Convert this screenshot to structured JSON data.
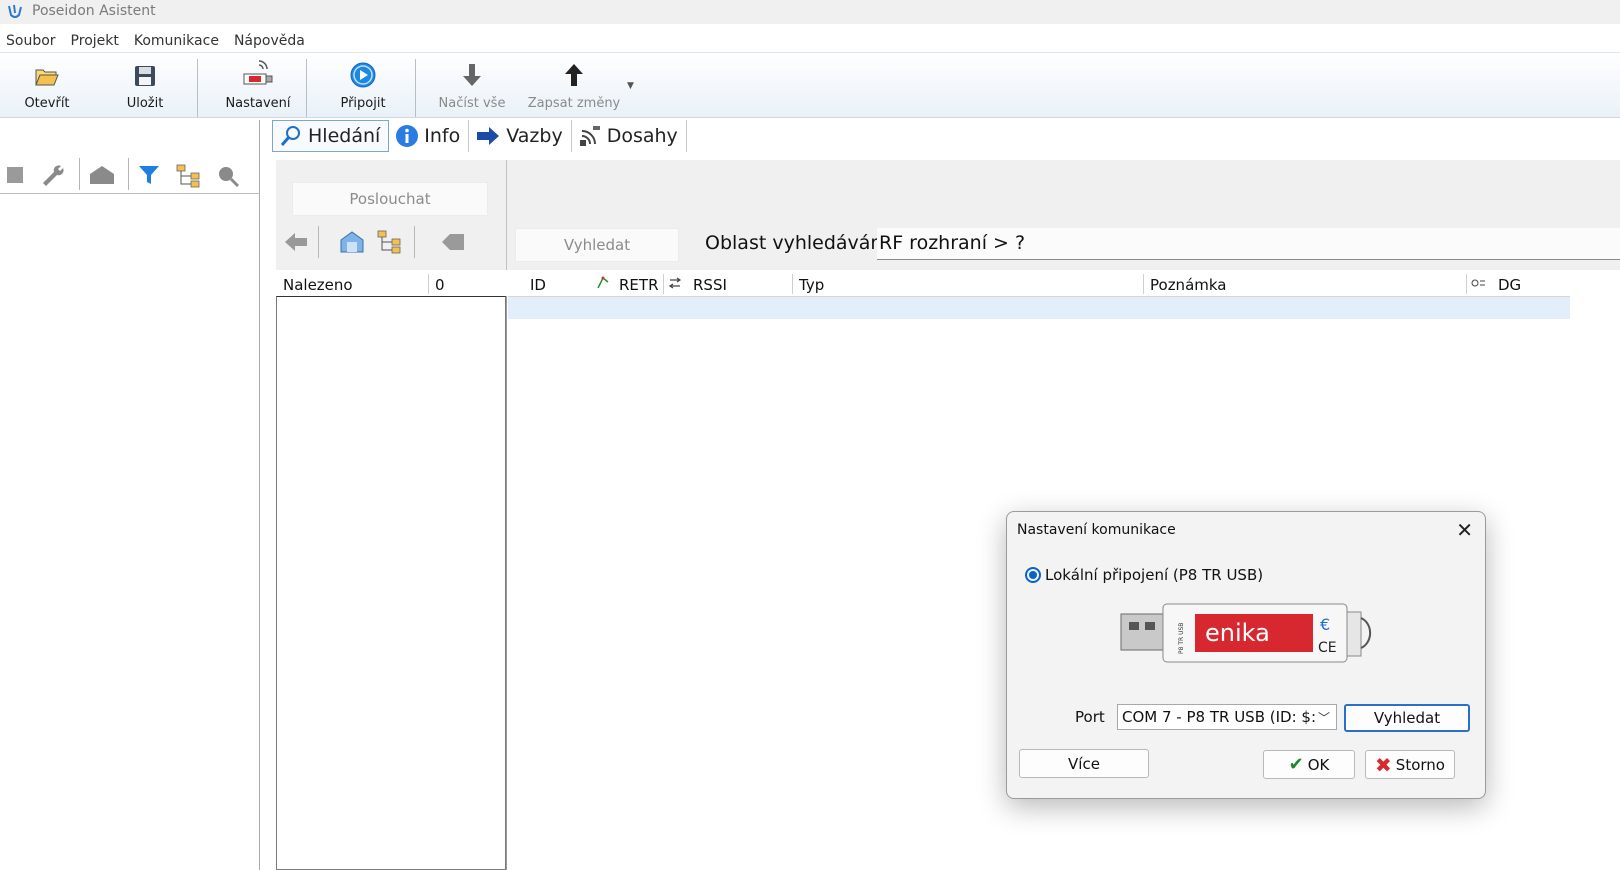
{
  "window": {
    "title": "Poseidon Asistent"
  },
  "menu": [
    "Soubor",
    "Projekt",
    "Komunikace",
    "Nápověda"
  ],
  "toolbar": {
    "open": "Otevřít",
    "save": "Uložit",
    "settings": "Nastavení",
    "connect": "Připojit",
    "read_all": "Načíst vše",
    "write_changes": "Zapsat změny"
  },
  "tabs": [
    "Hledání",
    "Info",
    "Vazby",
    "Dosahy"
  ],
  "search": {
    "listen_button": "Poslouchat",
    "search_button": "Vyhledat",
    "area_label": "Oblast vyhledávání",
    "area_value": "RF rozhraní > ?"
  },
  "found": {
    "label": "Nalezeno",
    "count": "0"
  },
  "table": {
    "columns": [
      "ID",
      "RETR",
      "RSSI",
      "Typ",
      "Poznámka",
      "DG"
    ]
  },
  "dialog": {
    "title": "Nastavení komunikace",
    "radio_label": "Lokální připojení (P8 TR USB)",
    "device_brand": "enika",
    "device_model": "P8 TR USB",
    "port_label": "Port",
    "port_value": "COM 7 - P8 TR USB (ID: $:",
    "search_button": "Vyhledat",
    "more_button": "Více",
    "ok_button": "OK",
    "cancel_button": "Storno"
  },
  "colors": {
    "accent": "#0a64c8",
    "tab_border": "#7aa7d4",
    "selected_row": "#e2eef9",
    "brand_red": "#d8282f"
  }
}
